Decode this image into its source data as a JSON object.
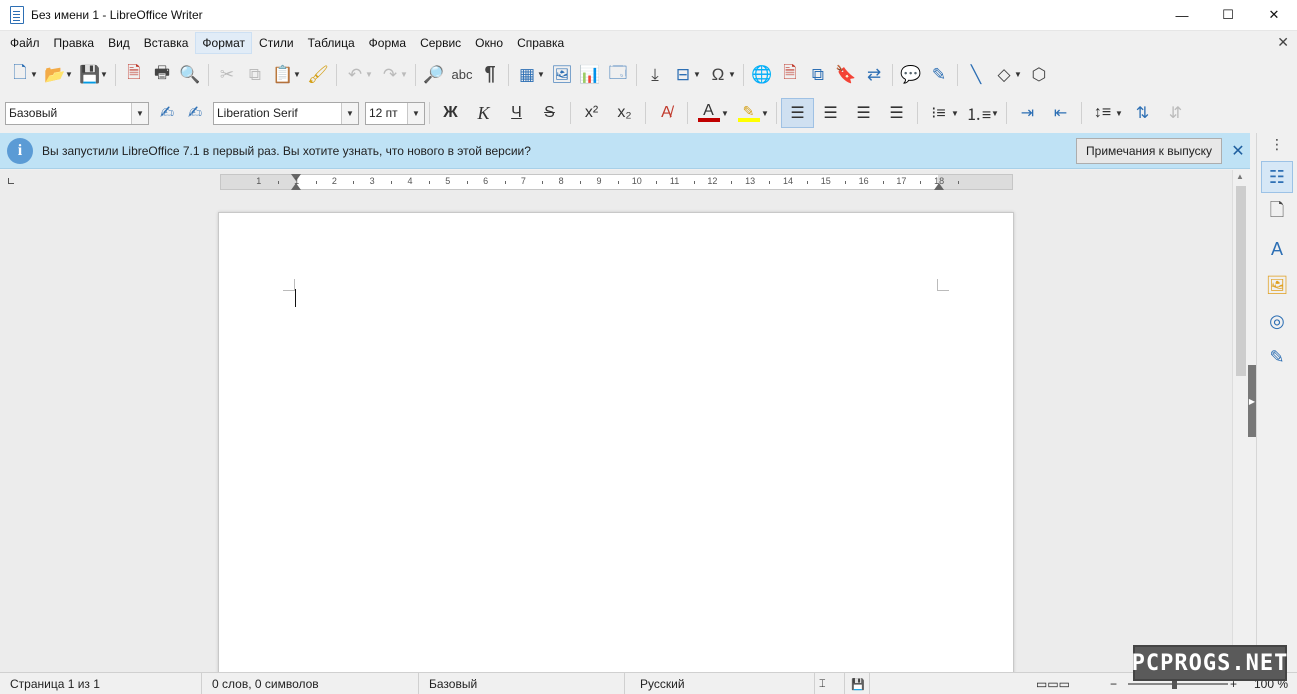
{
  "window": {
    "title": "Без имени 1 - LibreOffice Writer",
    "minimize": "—",
    "maximize": "☐",
    "close": "✕"
  },
  "menu": {
    "items": [
      "Файл",
      "Правка",
      "Вид",
      "Вставка",
      "Формат",
      "Стили",
      "Таблица",
      "Форма",
      "Сервис",
      "Окно",
      "Справка"
    ],
    "active": "Формат",
    "doc_close": "✕"
  },
  "formatting": {
    "paragraph_style": "Базовый",
    "font_name": "Liberation Serif",
    "font_size": "12 пт",
    "bold": "Ж",
    "italic": "К",
    "underline": "Ч",
    "strikethrough": "S",
    "superscript": "x²",
    "subscript": "x₂",
    "font_color": "#c00000",
    "highlight_color": "#ffff00"
  },
  "infobar": {
    "icon": "i",
    "message": "Вы запустили LibreOffice 7.1 в первый раз. Вы хотите узнать, что нового в этой версии?",
    "button": "Примечания к выпуску",
    "close": "✕"
  },
  "ruler": {
    "labels": [
      "1",
      "1",
      "2",
      "3",
      "4",
      "5",
      "6",
      "7",
      "8",
      "9",
      "10",
      "11",
      "12",
      "13",
      "14",
      "15",
      "16",
      "17",
      "18"
    ]
  },
  "statusbar": {
    "page": "Страница 1 из 1",
    "words": "0 слов, 0 символов",
    "style": "Базовый",
    "language": "Русский",
    "zoom_minus": "−",
    "zoom_plus": "+",
    "zoom": "100 %"
  },
  "watermark": "PCPROGS.NET",
  "icons": {
    "toolbar1": [
      "new-document-icon",
      "open-folder-icon",
      "save-icon",
      "export-pdf-icon",
      "print-icon",
      "print-preview-icon",
      "cut-icon",
      "copy-icon",
      "paste-icon",
      "clone-formatting-icon",
      "undo-icon",
      "redo-icon",
      "find-replace-icon",
      "spellcheck-icon",
      "formatting-marks-icon",
      "insert-table-icon",
      "insert-image-icon",
      "insert-chart-icon",
      "insert-textbox-icon",
      "page-break-icon",
      "insert-field-icon",
      "special-character-icon",
      "hyperlink-icon",
      "footnote-icon",
      "endnote-icon",
      "bookmark-icon",
      "cross-reference-icon",
      "comment-icon",
      "track-changes-icon",
      "line-icon",
      "basic-shapes-icon",
      "draw-functions-icon"
    ],
    "sidebar": [
      "properties-icon",
      "page-icon",
      "styles-icon",
      "gallery-icon",
      "navigator-icon",
      "manage-changes-icon"
    ]
  }
}
